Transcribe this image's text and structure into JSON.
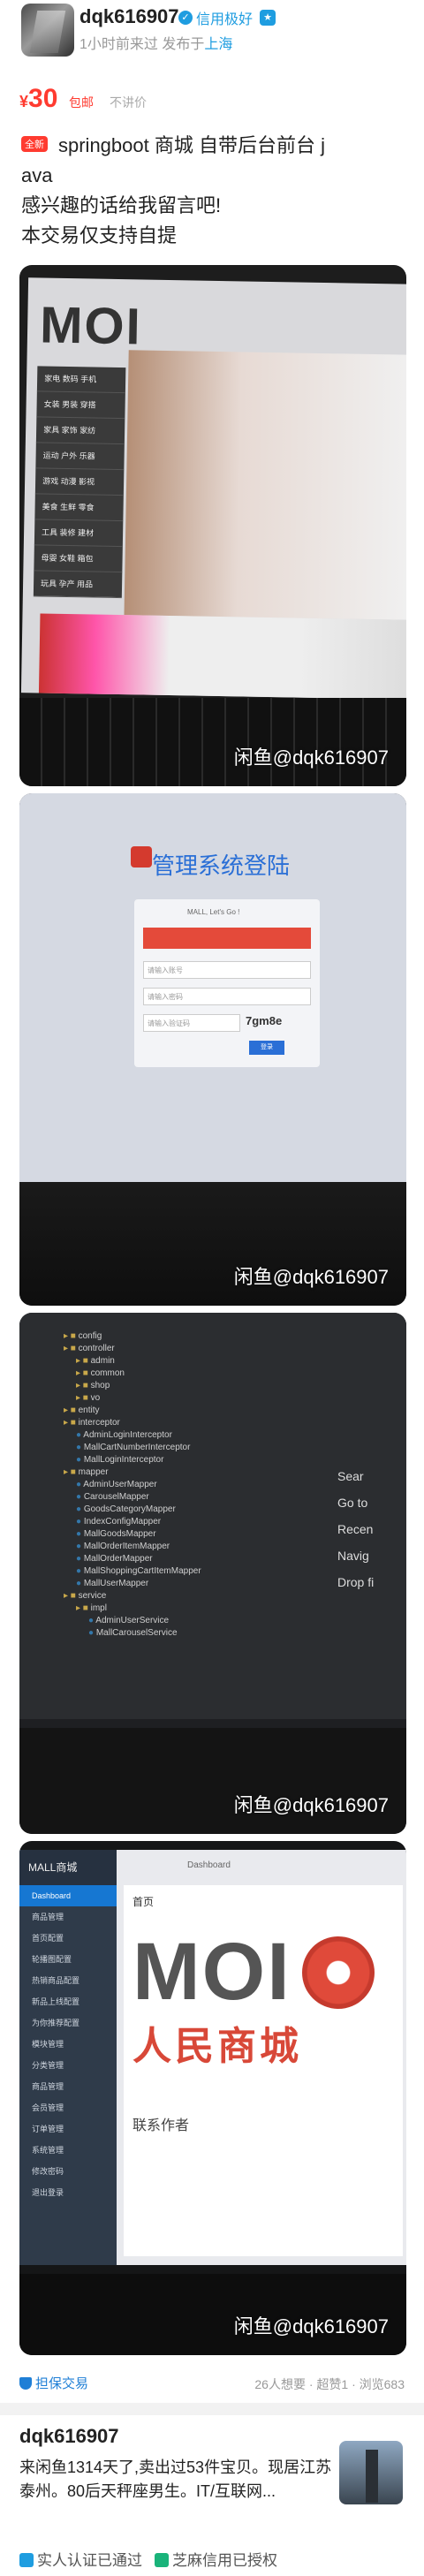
{
  "seller_header": {
    "username": "dqk616907",
    "credit_label": "信用极好",
    "time_text": "1小时前来过",
    "publish_prefix": "发布于",
    "location": "上海"
  },
  "price": {
    "currency": "¥",
    "amount": "30",
    "shipping_tag": "包邮",
    "bargain_tag": "不讲价"
  },
  "description": {
    "new_tag": "全新",
    "line1": "springboot 商城  自带后台前台 j",
    "line2": "ava",
    "line3": "感兴趣的话给我留言吧!",
    "line4": "本交易仅支持自提"
  },
  "photos": [
    {
      "watermark": "闲鱼@dqk616907",
      "logo": "MOI",
      "menu": [
        "家电 数码 手机",
        "女装 男装 穿搭",
        "家具 家饰 家纺",
        "运动 户外 乐器",
        "游戏 动漫 影视",
        "美食 生鲜 零食",
        "工具 装修 建材",
        "母婴 女鞋 箱包",
        "玩具 孕产 用品"
      ]
    },
    {
      "watermark": "闲鱼@dqk616907",
      "title": "管理系统登陆",
      "welcome": "MALL, Let's Go !",
      "user_placeholder": "请输入账号",
      "pass_placeholder": "请输入密码",
      "captcha_placeholder": "请输入验证码",
      "captcha": "7gm8e",
      "login": "登录"
    },
    {
      "watermark": "闲鱼@dqk616907",
      "tree": [
        "config",
        "controller",
        "admin",
        "common",
        "shop",
        "vo",
        "entity",
        "interceptor",
        "AdminLoginInterceptor",
        "MallCartNumberInterceptor",
        "MallLoginInterceptor",
        "mapper",
        "AdminUserMapper",
        "CarouselMapper",
        "GoodsCategoryMapper",
        "IndexConfigMapper",
        "MallGoodsMapper",
        "MallOrderItemMapper",
        "MallOrderMapper",
        "MallShoppingCartItemMapper",
        "MallUserMapper",
        "service",
        "impl",
        "AdminUserService",
        "MallCarouselService"
      ],
      "right_menu": [
        "Sear",
        "Go to",
        "Recen",
        "Navig",
        "Drop fi"
      ]
    },
    {
      "watermark": "闲鱼@dqk616907",
      "brand": "MALL商城",
      "nav": [
        "Dashboard",
        "商品管理",
        "首页配置",
        "轮播图配置",
        "热销商品配置",
        "新品上线配置",
        "为你推荐配置",
        "模块管理",
        "分类管理",
        "商品管理",
        "会员管理",
        "订单管理",
        "系统管理",
        "修改密码",
        "退出登录"
      ],
      "top_title": "Dashboard",
      "tab": "首页",
      "big_text": "MOI",
      "sub_text": "人民商城",
      "contact": "联系作者"
    }
  ],
  "footer": {
    "guarantee": "担保交易",
    "stats": "26人想要 · 超赞1 · 浏览683"
  },
  "seller_card": {
    "name": "dqk616907",
    "bio": "来闲鱼1314天了,卖出过53件宝贝。现居江苏泰州。80后天秤座男生。IT/互联网...",
    "verify1": "实人认证已通过",
    "verify2": "芝麻信用已授权"
  },
  "colors": {
    "price_red": "#ff3b30",
    "link_blue": "#1f9de0",
    "text_dark": "#222222",
    "text_grey": "#999999"
  }
}
